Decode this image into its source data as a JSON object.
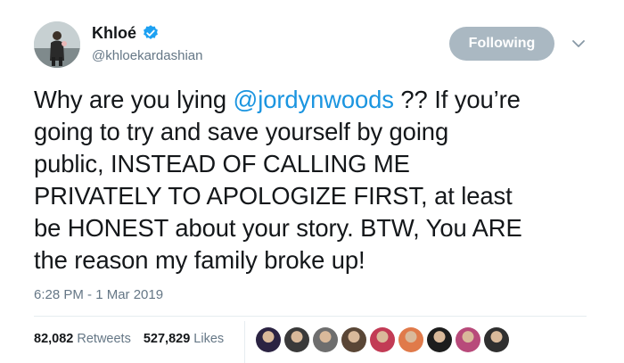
{
  "author": {
    "display_name": "Khloé",
    "handle": "@khloekardashian",
    "verified": true
  },
  "follow_button": {
    "label": "Following"
  },
  "tweet": {
    "lines": [
      {
        "before": "Why are you lying ",
        "mention": "@jordynwoods",
        "after": " ?? If you’re"
      },
      {
        "text": "going to try and save yourself by going"
      },
      {
        "text": "public, INSTEAD OF CALLING ME"
      },
      {
        "text": "PRIVATELY TO APOLOGIZE FIRST, at least"
      },
      {
        "text": "be HONEST about your story. BTW, You ARE"
      },
      {
        "text": "the reason my family broke up!"
      }
    ],
    "timestamp": "6:28 PM - 1 Mar 2019"
  },
  "stats": {
    "retweets_count": "82,082",
    "retweets_label": "Retweets",
    "likes_count": "527,829",
    "likes_label": "Likes"
  },
  "likers": [
    {
      "color": "#2b2342"
    },
    {
      "color": "#3a3a3a"
    },
    {
      "color": "#6e6e6e"
    },
    {
      "color": "#5a4636"
    },
    {
      "color": "#c23b55"
    },
    {
      "color": "#e07a4a"
    },
    {
      "color": "#1d1d1d"
    },
    {
      "color": "#b84a7a"
    },
    {
      "color": "#2f2f2f"
    }
  ],
  "colors": {
    "link": "#1b95e0",
    "secondary_text": "#657786",
    "following_button": "#aab8c2",
    "verified": "#1da1f2"
  }
}
